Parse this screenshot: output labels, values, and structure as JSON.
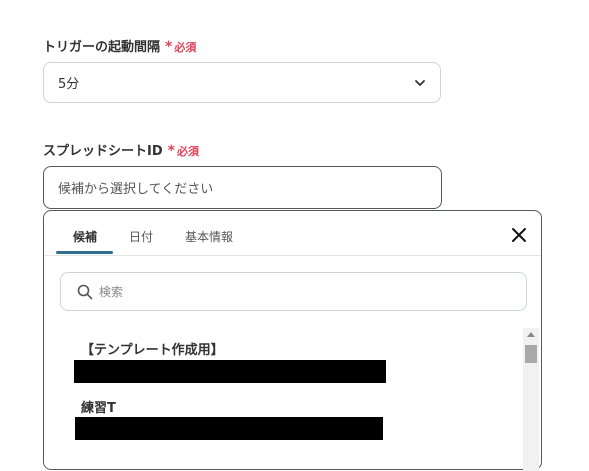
{
  "trigger_field": {
    "label": "トリガーの起動間隔",
    "required_star": "*",
    "required_text": "必須",
    "value": "5分"
  },
  "spreadsheet_field": {
    "label": "スプレッドシートID",
    "required_star": "*",
    "required_text": "必須",
    "placeholder": "候補から選択してください"
  },
  "dropdown": {
    "tabs": [
      {
        "label": "候補",
        "active": true
      },
      {
        "label": "日付",
        "active": false
      },
      {
        "label": "基本情報",
        "active": false
      }
    ],
    "search_placeholder": "検索",
    "items": [
      {
        "label": "【テンプレート作成用】"
      },
      {
        "label": "練習T"
      }
    ]
  },
  "colors": {
    "required": "#e0435b",
    "tab_underline": "#2f6f8f",
    "border_active": "#56595c",
    "border": "#cfd3d6"
  }
}
